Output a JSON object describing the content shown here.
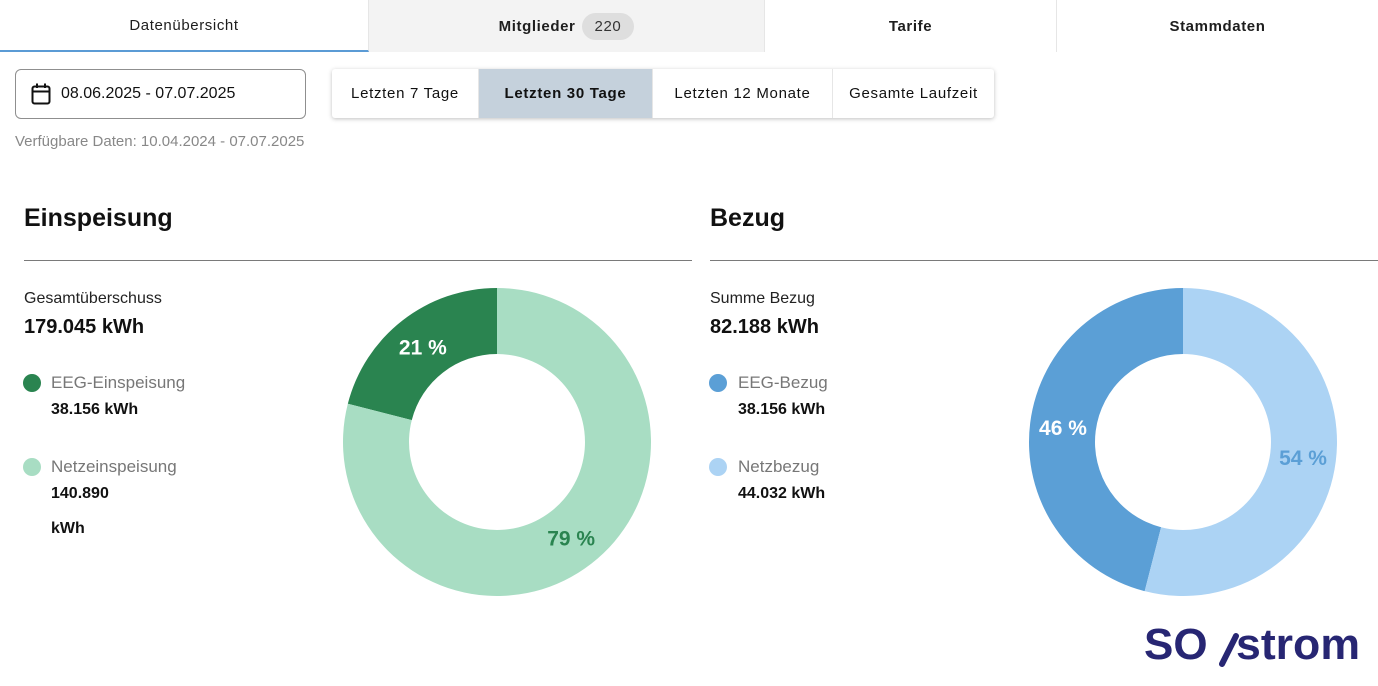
{
  "tabs": {
    "overview": "Datenübersicht",
    "members": "Mitglieder",
    "members_count": "220",
    "tariffs": "Tarife",
    "master_data": "Stammdaten"
  },
  "date_range": {
    "value": "08.06.2025 - 07.07.2025",
    "icon": "calendar-icon"
  },
  "periods": {
    "last7": "Letzten 7 Tage",
    "last30": "Letzten 30 Tage",
    "last12m": "Letzten 12 Monate",
    "all": "Gesamte Laufzeit",
    "selected": "last30"
  },
  "available": "Verfügbare Daten: 10.04.2024 - 07.07.2025",
  "einspeisung": {
    "title": "Einspeisung",
    "total_label": "Gesamtüberschuss",
    "total_value": "179.045 kWh",
    "items": [
      {
        "label": "EEG-Einspeisung",
        "value": "38.156 kWh",
        "color": "#2a8450"
      },
      {
        "label": "Netzeinspeisung",
        "value": "140.890",
        "unit": "kWh",
        "color": "#a8ddc3"
      }
    ],
    "donut": {
      "percents": [
        21,
        79
      ],
      "labels": [
        "21 %",
        "79 %"
      ],
      "colors": [
        "#2a8450",
        "#a8ddc3"
      ],
      "label_colors": [
        "#ffffff",
        "#2a8450"
      ]
    }
  },
  "bezug": {
    "title": "Bezug",
    "total_label": "Summe Bezug",
    "total_value": "82.188 kWh",
    "items": [
      {
        "label": "EEG-Bezug",
        "value": "38.156 kWh",
        "color": "#5b9fd6"
      },
      {
        "label": "Netzbezug",
        "value": "44.032 kWh",
        "color": "#acd3f4"
      }
    ],
    "donut": {
      "percents": [
        46,
        54
      ],
      "labels": [
        "46 %",
        "54 %"
      ],
      "colors": [
        "#5b9fd6",
        "#acd3f4"
      ],
      "label_colors": [
        "#ffffff",
        "#5b9fd6"
      ]
    }
  },
  "logo": {
    "text_left": "SO",
    "text_right": "strom",
    "color": "#272673"
  }
}
